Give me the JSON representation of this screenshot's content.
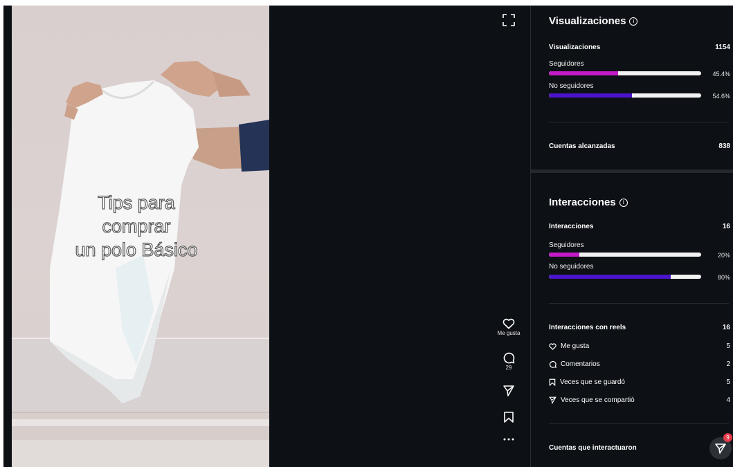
{
  "video": {
    "overlay_lines": [
      "Tips para",
      "comprar",
      "un polo Básico"
    ],
    "actions": {
      "like_label": "Me gusta",
      "comments_count": "29"
    }
  },
  "views": {
    "title": "Visualizaciones",
    "total_label": "Visualizaciones",
    "total_value": "1154",
    "followers_label": "Seguidores",
    "followers_pct": "45.4%",
    "followers_fraction": 0.454,
    "non_followers_label": "No seguidores",
    "non_followers_pct": "54.6%",
    "non_followers_fraction": 0.546,
    "reach_label": "Cuentas alcanzadas",
    "reach_value": "838"
  },
  "interactions": {
    "title": "Interacciones",
    "total_label": "Interacciones",
    "total_value": "16",
    "followers_label": "Seguidores",
    "followers_pct": "20%",
    "followers_fraction": 0.2,
    "non_followers_label": "No seguidores",
    "non_followers_pct": "80%",
    "non_followers_fraction": 0.8,
    "reels_label": "Interacciones con reels",
    "reels_value": "16",
    "items": [
      {
        "icon": "heart-icon",
        "label": "Me gusta",
        "value": "5"
      },
      {
        "icon": "comment-icon",
        "label": "Comentarios",
        "value": "2"
      },
      {
        "icon": "bookmark-icon",
        "label": "Veces que se guardó",
        "value": "5"
      },
      {
        "icon": "share-icon",
        "label": "Veces que se compartió",
        "value": "4"
      }
    ],
    "accounts_label": "Cuentas que interactuaron"
  },
  "fab": {
    "badge": "9"
  },
  "colors": {
    "followers": "#c21bc6",
    "non_followers": "#4a14c9",
    "background": "#0d1015"
  }
}
